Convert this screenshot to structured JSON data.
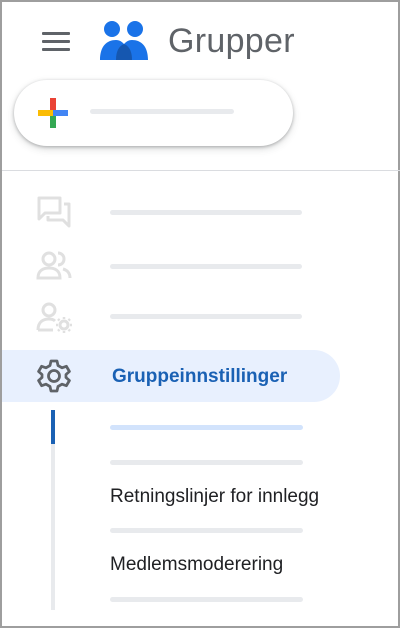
{
  "header": {
    "app_title": "Grupper",
    "menu_icon": "menu-icon",
    "logo_icon": "groups-logo-icon"
  },
  "create": {
    "icon": "plus-icon"
  },
  "nav": {
    "items": [
      {
        "icon": "forum-icon"
      },
      {
        "icon": "people-icon"
      },
      {
        "icon": "manage-accounts-icon"
      }
    ],
    "active": {
      "icon": "gear-icon",
      "label": "Gruppeinnstillinger"
    }
  },
  "subnav": {
    "items": [
      {
        "label": "Retningslinjer for innlegg"
      },
      {
        "label": "Medlemsmoderering"
      }
    ]
  },
  "colors": {
    "accent": "#1a61b4",
    "active_bg": "#e8f0fe",
    "icon_grey": "#5f6368",
    "placeholder": "#e8eaed"
  }
}
